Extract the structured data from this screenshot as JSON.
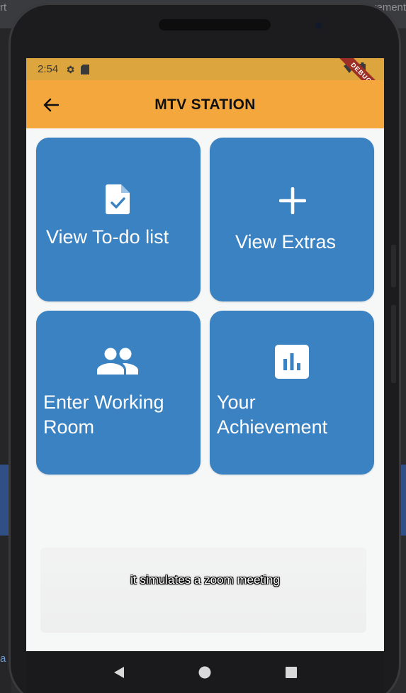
{
  "ide": {
    "top_left_text": "rt",
    "top_right_text": "achievement.d",
    "left_letter": "a"
  },
  "status_bar": {
    "time": "2:54",
    "debug_label": "DEBUG"
  },
  "app_bar": {
    "title": "MTV STATION",
    "back_icon": "arrow-back-icon"
  },
  "cards": [
    {
      "label": "View To-do list",
      "icon": "task-document-icon"
    },
    {
      "label": "View Extras",
      "icon": "plus-icon"
    },
    {
      "label": "Enter Working Room",
      "icon": "people-icon"
    },
    {
      "label": "Your Achievement",
      "icon": "bar-chart-icon"
    }
  ],
  "caption": "it simulates a zoom meeting",
  "colors": {
    "app_bar": "#f3a73c",
    "status_bar": "#dca53d",
    "card": "#3b82c2",
    "debug_ribbon": "#9c3027"
  }
}
